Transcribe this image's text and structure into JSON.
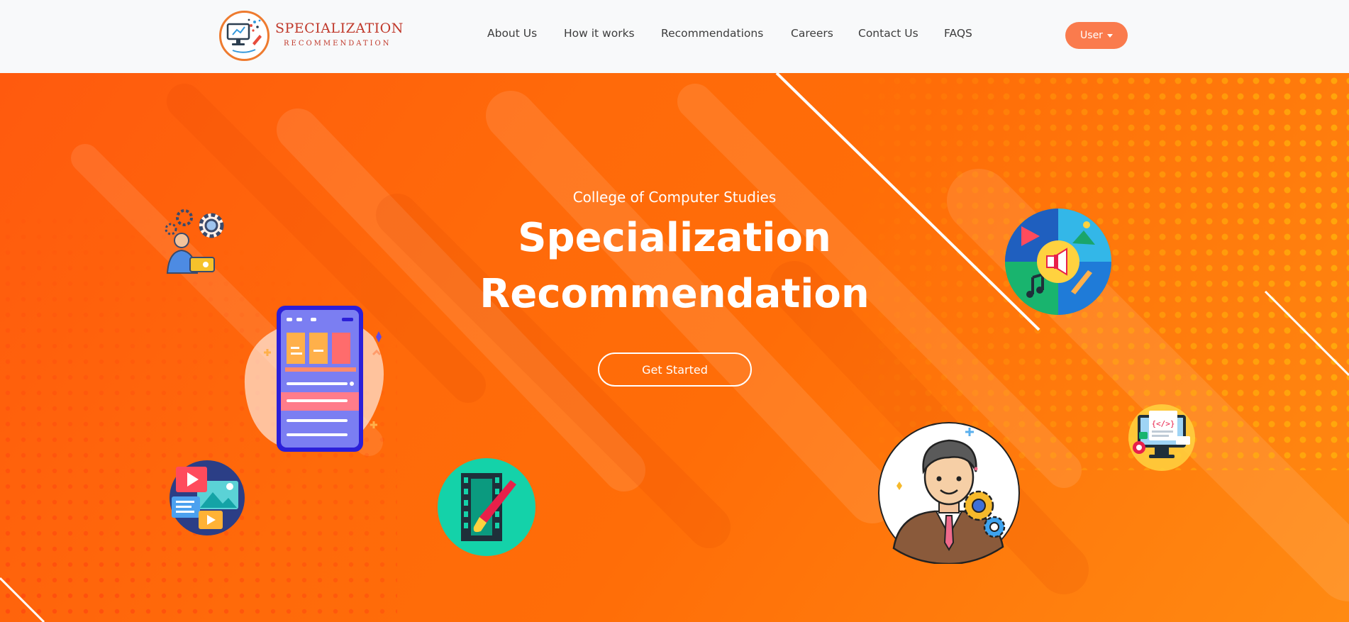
{
  "brand": {
    "title": "SPECIALIZATION",
    "subtitle": "RECOMMENDATION"
  },
  "nav": {
    "links": [
      "About Us",
      "How it works",
      "Recommendations",
      "Careers",
      "Contact Us",
      "FAQS"
    ],
    "user_label": "User"
  },
  "hero": {
    "subtitle": "College of Computer Studies",
    "title_line1": "Specialization",
    "title_line2": "Recommendation",
    "cta_label": "Get Started"
  },
  "colors": {
    "accent": "#fa7b4d",
    "hero_orange": "#ff6a0a",
    "brand_red": "#c0392b",
    "nav_bg": "#f8f9fa"
  },
  "icons": [
    "monitor-logo-icon",
    "caret-down-icon",
    "gears-worker-icon",
    "mobile-app-icon",
    "media-gallery-icon",
    "film-brush-icon",
    "businessman-gears-icon",
    "multimedia-wheel-icon",
    "code-monitor-icon"
  ]
}
